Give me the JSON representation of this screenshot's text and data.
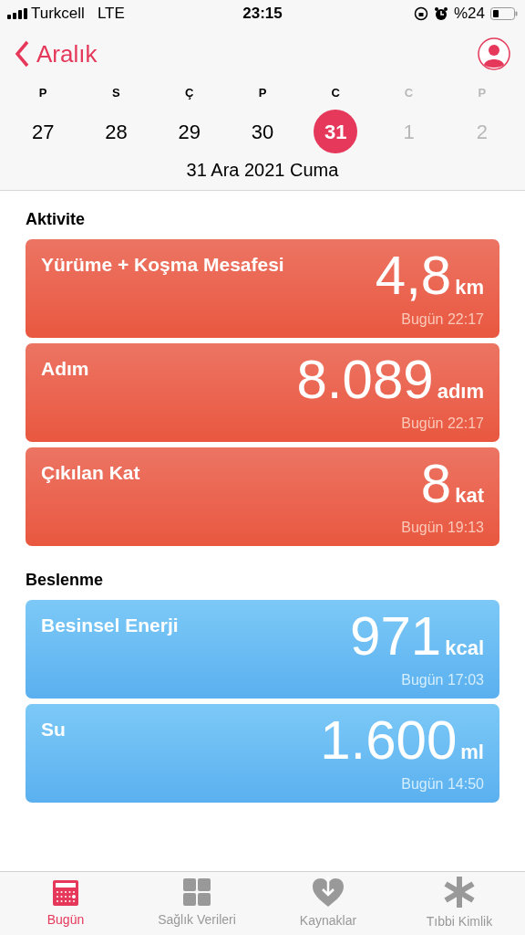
{
  "status_bar": {
    "carrier": "Turkcell",
    "network": "LTE",
    "time": "23:15",
    "battery": "%24"
  },
  "nav": {
    "back": "Aralık"
  },
  "week": [
    {
      "letter": "P",
      "day": "27",
      "selected": false,
      "future": false
    },
    {
      "letter": "S",
      "day": "28",
      "selected": false,
      "future": false
    },
    {
      "letter": "Ç",
      "day": "29",
      "selected": false,
      "future": false
    },
    {
      "letter": "P",
      "day": "30",
      "selected": false,
      "future": false
    },
    {
      "letter": "C",
      "day": "31",
      "selected": true,
      "future": false
    },
    {
      "letter": "C",
      "day": "1",
      "selected": false,
      "future": true
    },
    {
      "letter": "P",
      "day": "2",
      "selected": false,
      "future": true
    }
  ],
  "date_label": "31 Ara 2021 Cuma",
  "sections": [
    {
      "title": "Aktivite",
      "kind": "activity",
      "cards": [
        {
          "title": "Yürüme + Koşma Mesafesi",
          "value": "4,8",
          "unit": "km",
          "time": "Bugün 22:17"
        },
        {
          "title": "Adım",
          "value": "8.089",
          "unit": "adım",
          "time": "Bugün 22:17"
        },
        {
          "title": "Çıkılan Kat",
          "value": "8",
          "unit": "kat",
          "time": "Bugün 19:13"
        }
      ]
    },
    {
      "title": "Beslenme",
      "kind": "nutrition",
      "cards": [
        {
          "title": "Besinsel Enerji",
          "value": "971",
          "unit": "kcal",
          "time": "Bugün 17:03"
        },
        {
          "title": "Su",
          "value": "1.600",
          "unit": "ml",
          "time": "Bugün 14:50"
        }
      ]
    }
  ],
  "tabs": [
    {
      "label": "Bugün",
      "kind": "today",
      "selected": true
    },
    {
      "label": "Sağlık Verileri",
      "kind": "grid",
      "selected": false
    },
    {
      "label": "Kaynaklar",
      "kind": "sources",
      "selected": false
    },
    {
      "label": "Tıbbi Kimlik",
      "kind": "medical",
      "selected": false
    }
  ]
}
